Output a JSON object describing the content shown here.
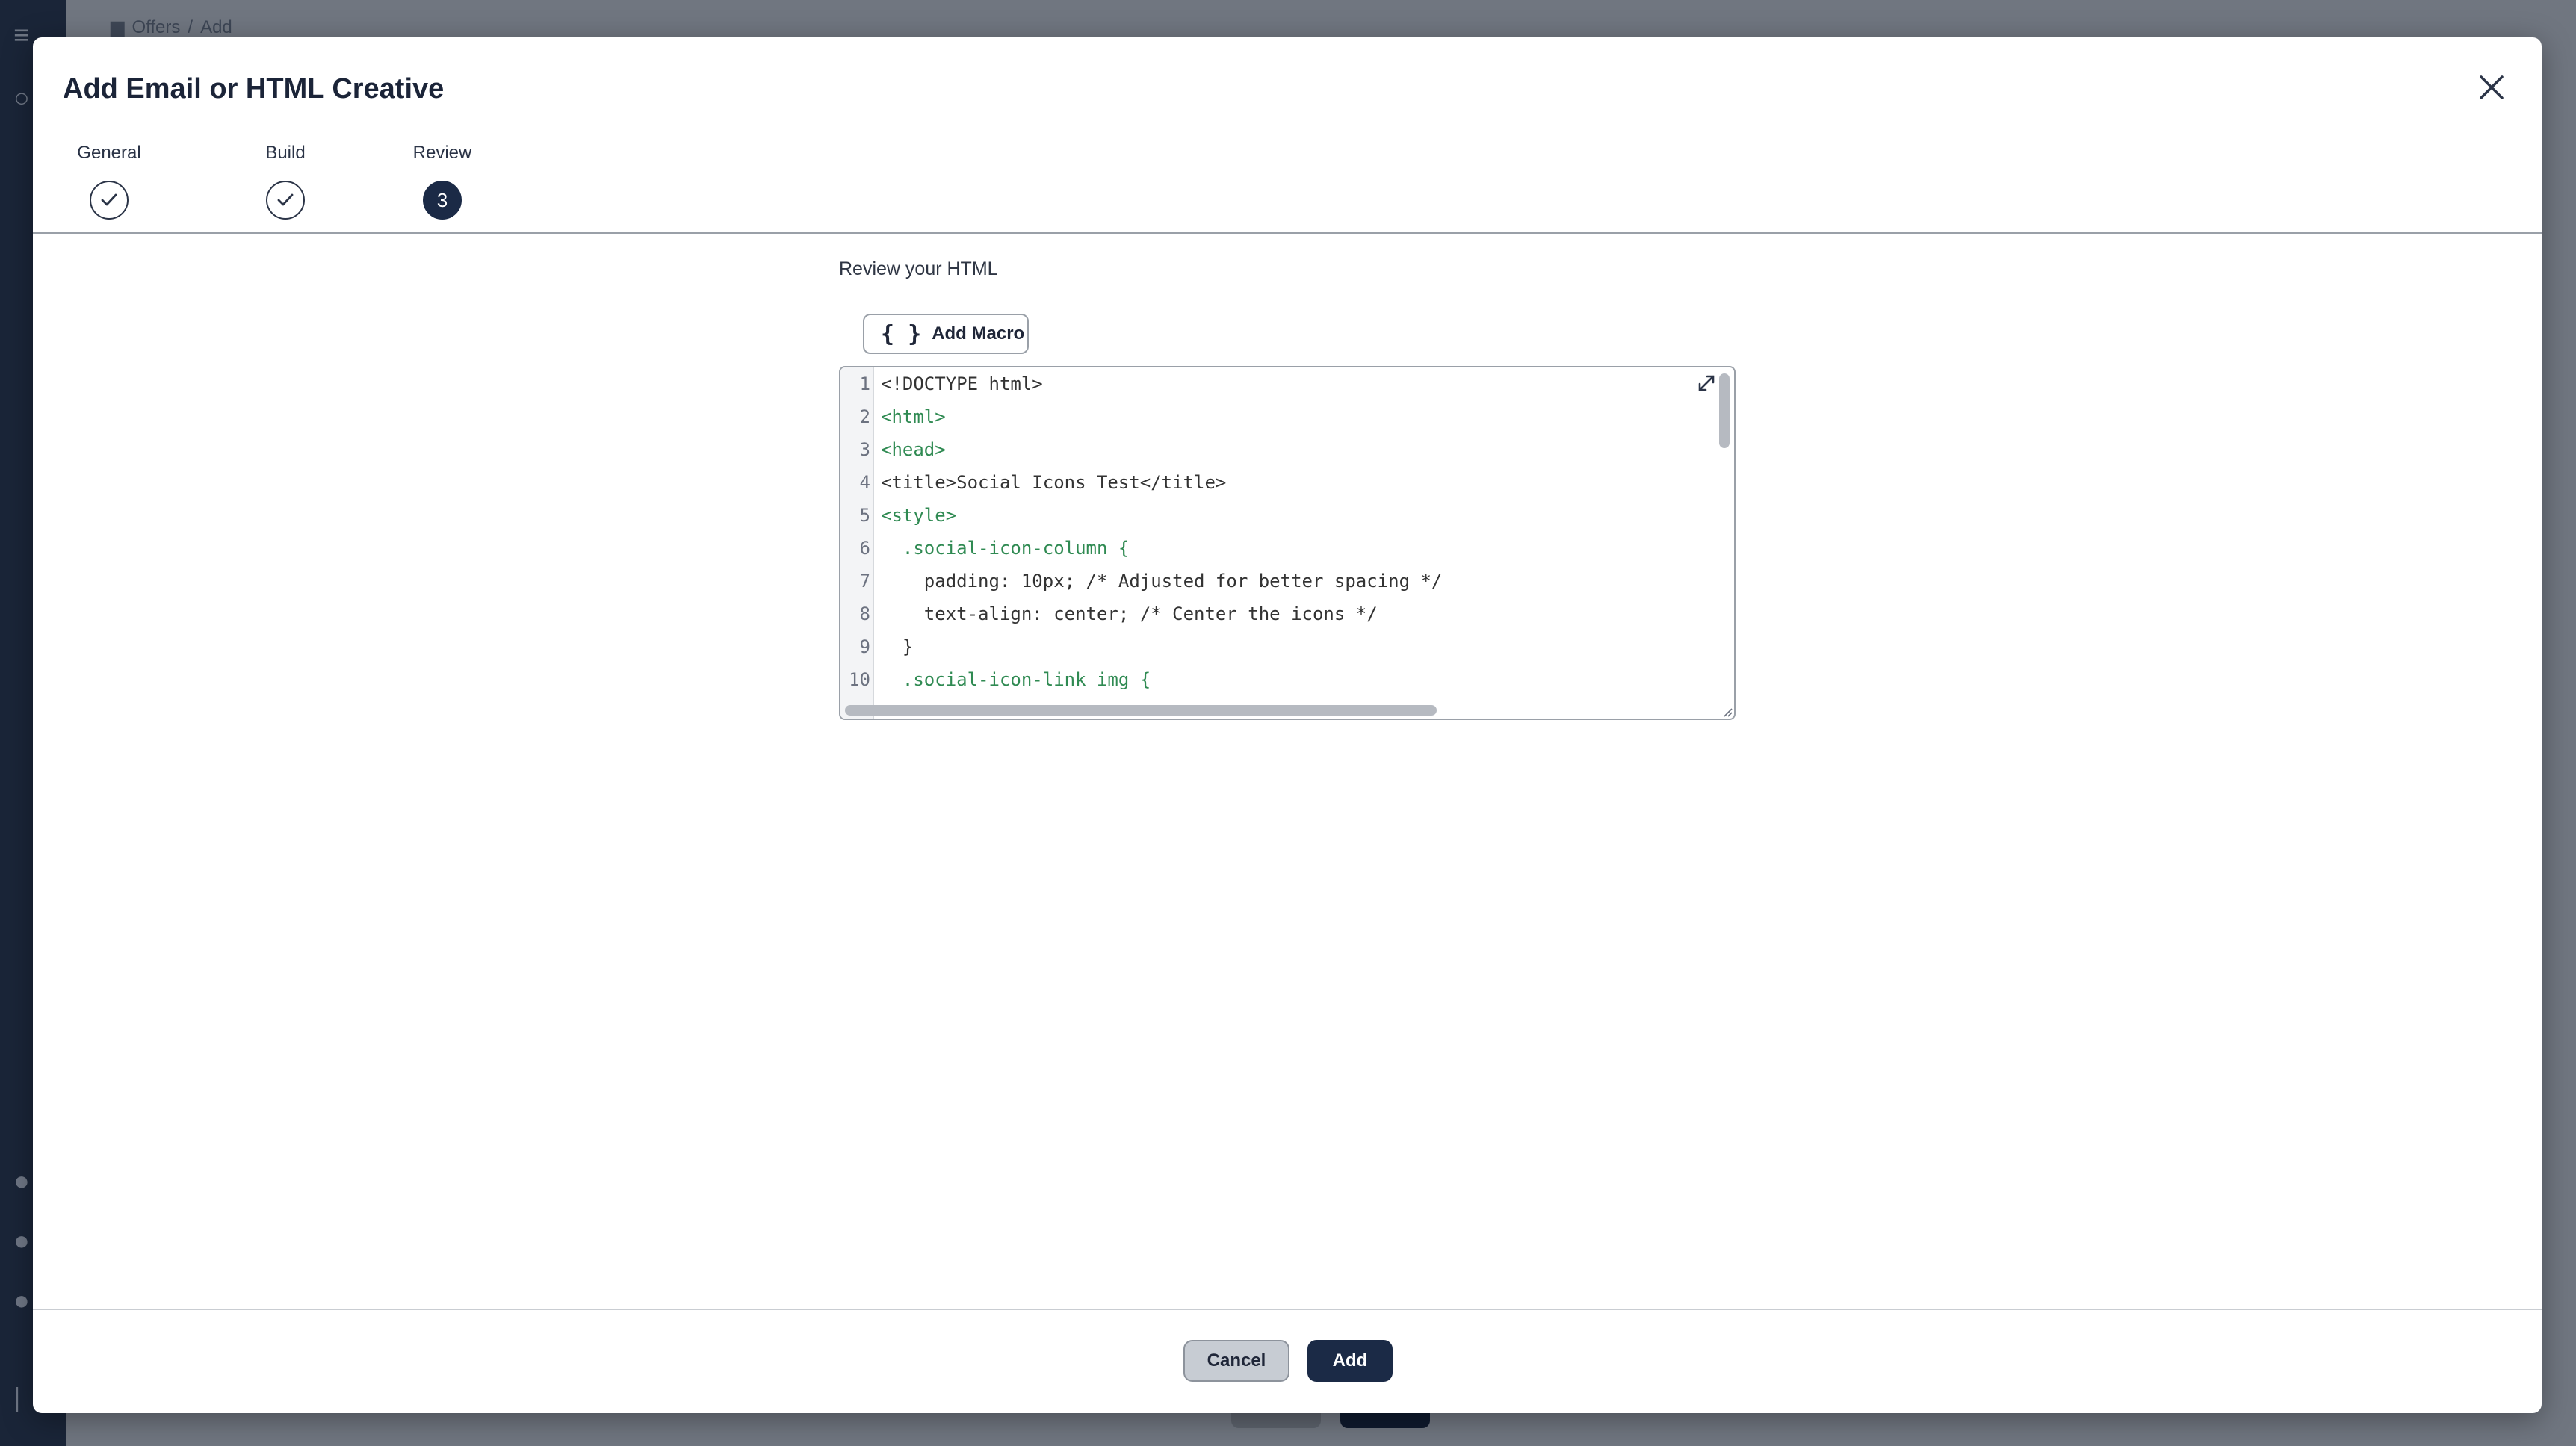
{
  "background": {
    "breadcrumb": {
      "section": "Offers",
      "separator": "/",
      "current": "Add"
    }
  },
  "modal": {
    "title": "Add Email or HTML Creative",
    "close_icon": "close-icon",
    "steps": [
      {
        "label": "General",
        "state": "complete"
      },
      {
        "label": "Build",
        "state": "complete"
      },
      {
        "label": "Review",
        "state": "active",
        "number": "3"
      }
    ],
    "review_label": "Review your HTML",
    "add_macro_label": "Add Macro",
    "editor": {
      "line_numbers": [
        "1",
        "2",
        "3",
        "4",
        "5",
        "6",
        "7",
        "8",
        "9",
        "10"
      ],
      "lines": [
        "<!DOCTYPE html>",
        "<html>",
        "<head>",
        "<title>Social Icons Test</title>",
        "<style>",
        "  .social-icon-column {",
        "    padding: 10px; /* Adjusted for better spacing */",
        "    text-align: center; /* Center the icons */",
        "  }",
        "  .social-icon-link img {"
      ]
    },
    "cancel_label": "Cancel",
    "add_label": "Add"
  },
  "colors": {
    "primary": "#1b2a46",
    "overlay": "#6b7079",
    "sidebar": "#1a2538"
  }
}
